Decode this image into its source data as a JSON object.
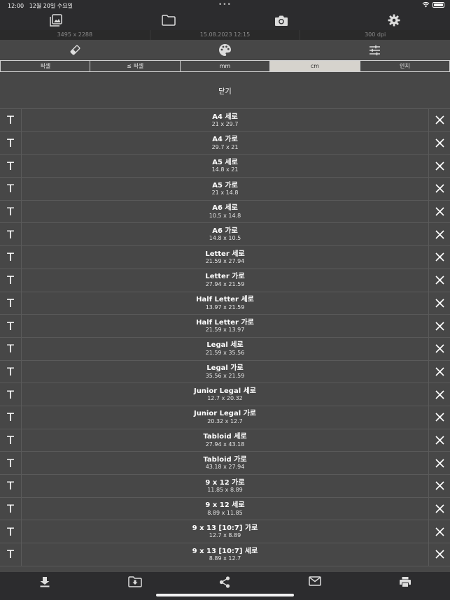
{
  "status": {
    "time": "12:00",
    "date": "12월 20일 수요일",
    "dots": "•••",
    "battery_level": 1.0
  },
  "toolbar": {
    "icons": [
      "photo-library-icon",
      "folder-icon",
      "camera-icon",
      "gear-icon"
    ]
  },
  "info": {
    "resolution": "3495 x 2288",
    "datetime": "15.08.2023 12:15",
    "dpi": "300 dpi"
  },
  "toolbar2": {
    "icons": [
      "eraser-icon",
      "palette-icon",
      "sliders-icon"
    ]
  },
  "units": {
    "options": [
      "픽셀",
      "≤ 픽셀",
      "mm",
      "cm",
      "인치"
    ],
    "selected": "cm"
  },
  "close_label": "닫기",
  "presets": [
    {
      "name": "A4 세로",
      "size": "21 x 29.7"
    },
    {
      "name": "A4 가로",
      "size": "29.7 x 21"
    },
    {
      "name": "A5 세로",
      "size": "14.8 x 21"
    },
    {
      "name": "A5 가로",
      "size": "21 x 14.8"
    },
    {
      "name": "A6 세로",
      "size": "10.5 x 14.8"
    },
    {
      "name": "A6 가로",
      "size": "14.8 x 10.5"
    },
    {
      "name": "Letter 세로",
      "size": "21.59 x 27.94"
    },
    {
      "name": "Letter 가로",
      "size": "27.94 x 21.59"
    },
    {
      "name": "Half Letter 세로",
      "size": "13.97 x 21.59"
    },
    {
      "name": "Half Letter 가로",
      "size": "21.59 x 13.97"
    },
    {
      "name": "Legal 세로",
      "size": "21.59 x 35.56"
    },
    {
      "name": "Legal 가로",
      "size": "35.56 x 21.59"
    },
    {
      "name": "Junior Legal 세로",
      "size": "12.7 x 20.32"
    },
    {
      "name": "Junior Legal 가로",
      "size": "20.32 x 12.7"
    },
    {
      "name": "Tabloid 세로",
      "size": "27.94 x 43.18"
    },
    {
      "name": "Tabloid 가로",
      "size": "43.18 x 27.94"
    },
    {
      "name": "9 x 12 가로",
      "size": "11.85 x 8.89"
    },
    {
      "name": "9 x 12 세로",
      "size": "8.89 x 11.85"
    },
    {
      "name": "9 x 13 [10:7] 가로",
      "size": "12.7 x 8.89"
    },
    {
      "name": "9 x 13 [10:7] 세로",
      "size": "8.89 x 12.7"
    }
  ],
  "row_text_icon": "T",
  "bottom": {
    "icons": [
      "download-icon",
      "folder-download-icon",
      "share-icon",
      "mail-icon",
      "printer-icon"
    ]
  }
}
